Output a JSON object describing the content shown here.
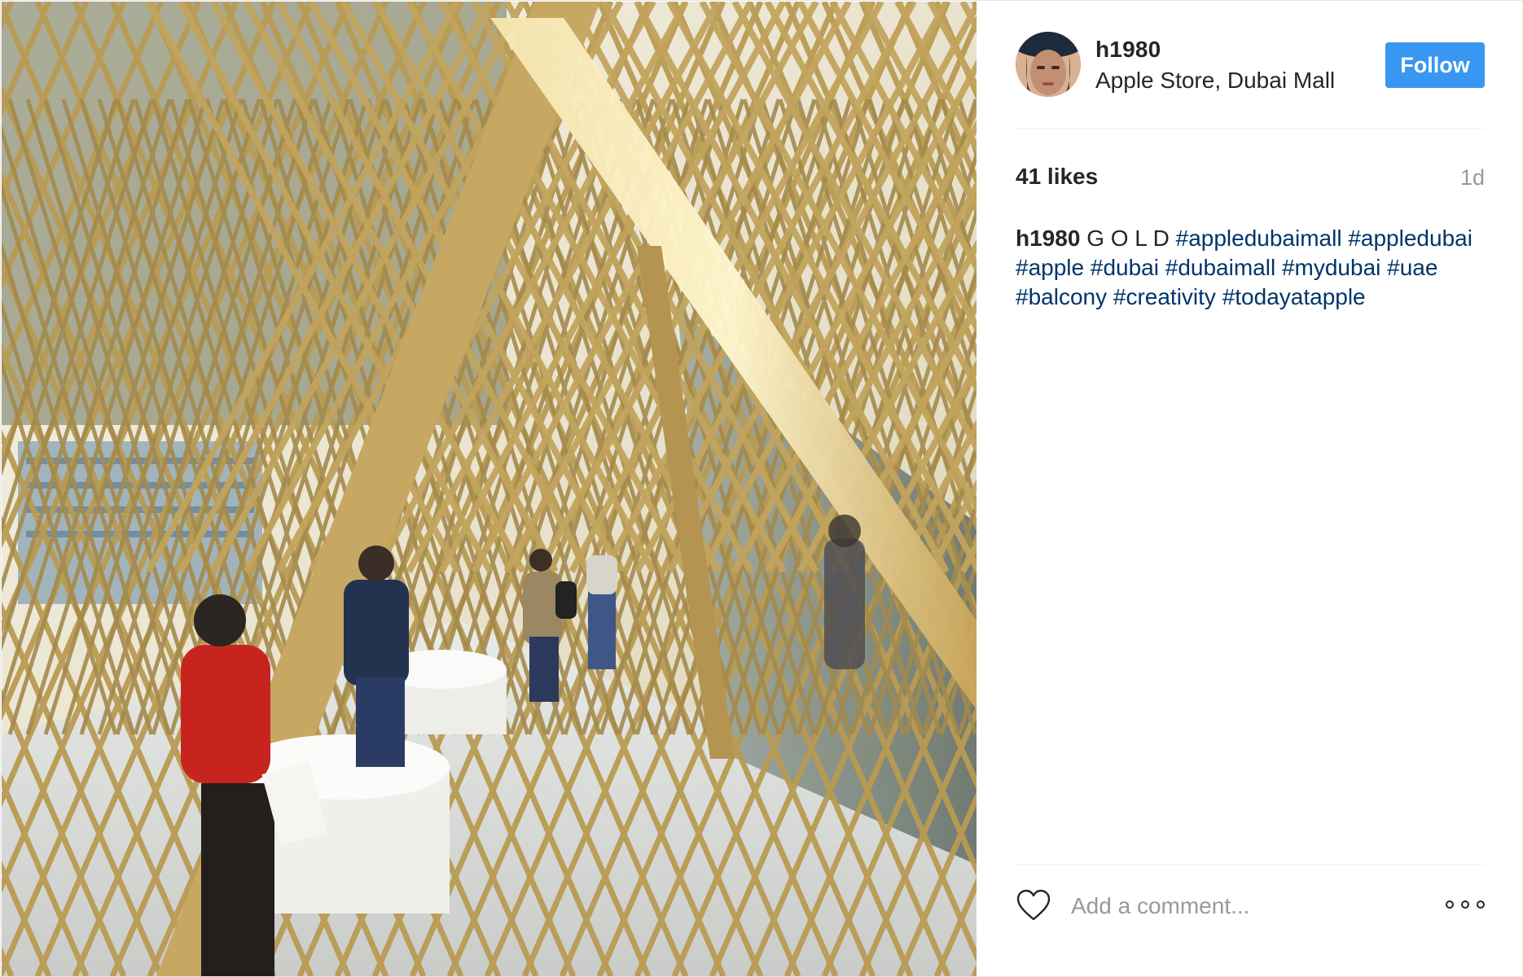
{
  "post": {
    "photo": {
      "description_icon": "photo",
      "subject": "gold-lattice-pavilion",
      "people": [
        {
          "name": "tourist-red-shirt"
        },
        {
          "name": "man-dark-shirt"
        },
        {
          "name": "man-backpack"
        },
        {
          "name": "walker-jeans"
        }
      ]
    },
    "header": {
      "username": "h1980",
      "location": "Apple Store, Dubai Mall",
      "follow_label": "Follow"
    },
    "likes": "41 likes",
    "timestamp": "1d",
    "caption": {
      "username": "h1980",
      "text": "G O L D",
      "hashtags": [
        "#appledubaimall",
        "#appledubai",
        "#apple",
        "#dubai",
        "#dubaimall",
        "#mydubai",
        "#uae",
        "#balcony",
        "#creativity",
        "#todayatapple"
      ]
    },
    "footer": {
      "comment_placeholder": "Add a comment...",
      "like_icon": "heart-icon",
      "more_icon": "more-options-icon"
    }
  },
  "colors": {
    "follow_button": "#3897f0",
    "hashtag": "#003569",
    "text": "#262626",
    "muted": "#999999",
    "divider": "#efefef"
  }
}
